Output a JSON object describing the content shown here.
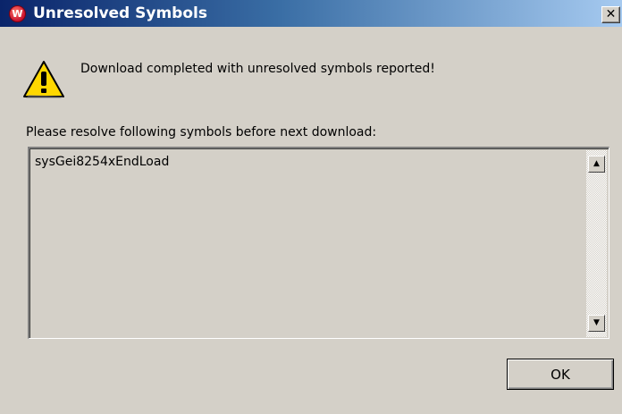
{
  "window": {
    "title": "Unresolved Symbols",
    "app_icon_label": "W",
    "close_glyph": "✕"
  },
  "icons": {
    "app": "windriver-app-icon",
    "warning": "warning-icon",
    "scroll_up": "scroll-up-arrow-icon",
    "scroll_down": "scroll-down-arrow-icon"
  },
  "message": "Download completed with unresolved symbols reported!",
  "instruction": "Please resolve following symbols before next download:",
  "symbols": [
    "sysGei8254xEndLoad"
  ],
  "scrollbar": {
    "up_glyph": "▲",
    "down_glyph": "▼"
  },
  "buttons": {
    "ok": "OK"
  },
  "colors": {
    "dialog_bg": "#d4d0c8",
    "titlebar_start": "#0a246a",
    "titlebar_end": "#a6caf0",
    "warning_yellow": "#ffd800"
  }
}
